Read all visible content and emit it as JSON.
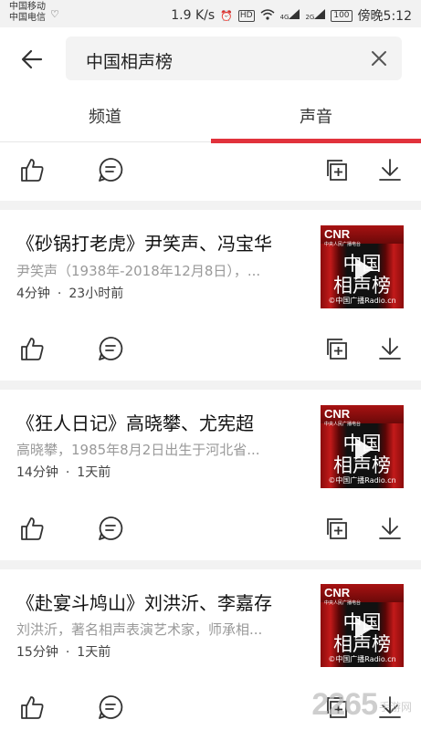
{
  "status_bar": {
    "carrier_1": "中国移动",
    "carrier_2": "中国电信",
    "speed": "1.9 K/s",
    "network_tag": "4G",
    "network_tag_2": "2G",
    "hd_badge": "HD",
    "battery": "100",
    "time": "傍晚5:12"
  },
  "search": {
    "query": "中国相声榜"
  },
  "tabs": [
    {
      "label": "频道",
      "active": false
    },
    {
      "label": "声音",
      "active": true
    }
  ],
  "items": [
    {
      "title": "《砂锅打老虎》尹笑声、冯宝华",
      "desc": "尹笑声（1938年-2018年12月8日），...",
      "duration": "4分钟",
      "time_ago": "23小时前"
    },
    {
      "title": "《狂人日记》高晓攀、尤宪超",
      "desc": "高晓攀，1985年8月2日出生于河北省...",
      "duration": "14分钟",
      "time_ago": "1天前"
    },
    {
      "title": "《赴宴斗鸠山》刘洪沂、李嘉存",
      "desc": "刘洪沂，著名相声表演艺术家，师承相...",
      "duration": "15分钟",
      "time_ago": "1天前"
    }
  ],
  "thumbnail": {
    "brand": "CNR",
    "brand_sub": "中央人民广播电台",
    "line1": "中国",
    "line2": "相声榜",
    "footer": "©中国广播Radio.cn"
  },
  "meta_separator": "·",
  "watermark": {
    "text": "2265",
    "sub": "手游网"
  },
  "colors": {
    "accent": "#e1323c",
    "muted_text": "#999999",
    "separator": "#f2f2f2"
  },
  "icons": [
    "back-arrow-icon",
    "clear-icon",
    "thumbs-up-icon",
    "comment-icon",
    "add-to-playlist-icon",
    "download-icon",
    "play-icon"
  ]
}
